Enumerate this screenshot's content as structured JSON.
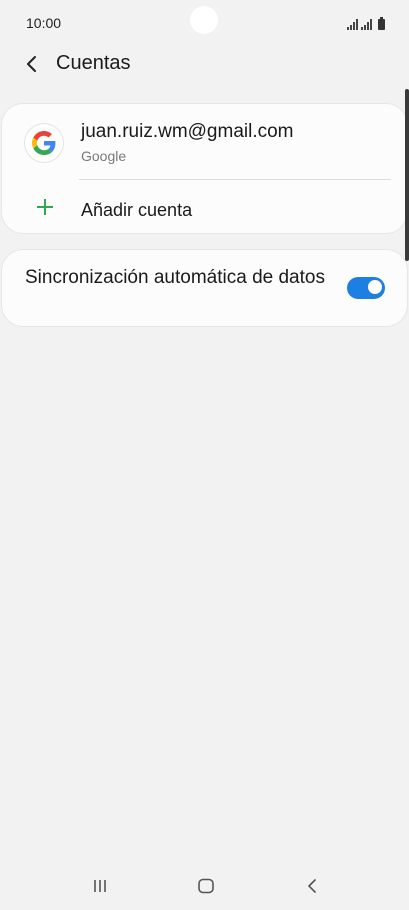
{
  "status_bar": {
    "time": "10:00"
  },
  "header": {
    "title": "Cuentas"
  },
  "accounts": [
    {
      "email": "juan.ruiz.wm@gmail.com",
      "type": "Google",
      "icon": "google-logo-icon"
    }
  ],
  "add_account": {
    "label": "Añadir cuenta",
    "icon": "plus-icon"
  },
  "auto_sync": {
    "label": "Sincronización automática de datos",
    "enabled": true
  },
  "colors": {
    "background": "#f2f2f2",
    "card": "#fcfcfc",
    "accent_blue": "#1e7fe3",
    "add_green": "#2fa84f"
  },
  "icons": {
    "back": "chevron-left-icon",
    "recents": "recents-icon",
    "home": "home-icon",
    "nav_back": "nav-back-icon"
  }
}
